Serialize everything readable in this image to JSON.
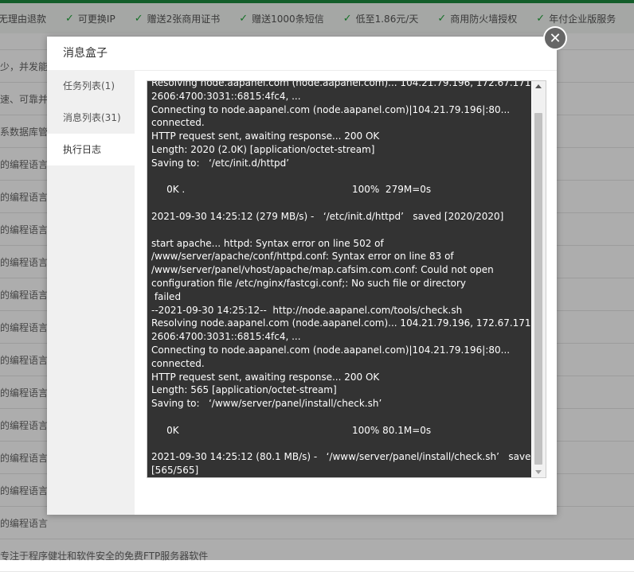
{
  "background": {
    "features": [
      "无理由退款",
      "可更换IP",
      "赠送2张商用证书",
      "赠送1000条短信",
      "低至1.86元/天",
      "商用防火墙授权",
      "年付企业版服务"
    ],
    "rows": [
      "少，并发能",
      "速、可靠并",
      "系数据库管理",
      "的编程语言",
      "的编程语言",
      "的编程语言",
      "的编程语言",
      "的编程语言",
      "的编程语言",
      "的编程语言",
      "的编程语言",
      "的编程语言",
      "的编程语言",
      "的编程语言",
      "的编程语言",
      "专注于程序健壮和软件安全的免费FTP服务器软件"
    ]
  },
  "modal": {
    "title": "消息盒子",
    "close_symbol": "✕",
    "tabs": [
      {
        "label": "任务列表(1)"
      },
      {
        "label": "消息列表(31)"
      },
      {
        "label": "执行日志"
      }
    ],
    "active_tab": "执行日志",
    "log_lines": [
      "Resolving node.aapanel.com (node.aapanel.com)... 104.21.79.196, 172.67.171.7,",
      "2606:4700:3031::6815:4fc4, ...",
      "Connecting to node.aapanel.com (node.aapanel.com)|104.21.79.196|:80...",
      "connected.",
      "HTTP request sent, awaiting response... 200 OK",
      "Length: 2020 (2.0K) [application/octet-stream]",
      "Saving to:   ‘/etc/init.d/httpd’",
      "",
      "     0K .                                                       100%  279M=0s",
      "",
      "2021-09-30 14:25:12 (279 MB/s) -   ‘/etc/init.d/httpd’   saved [2020/2020]",
      "",
      "start apache... httpd: Syntax error on line 502 of",
      "/www/server/apache/conf/httpd.conf: Syntax error on line 83 of",
      "/www/server/panel/vhost/apache/map.cafsim.com.conf: Could not open",
      "configuration file /etc/nginx/fastcgi.conf;: No such file or directory",
      " failed",
      "--2021-09-30 14:25:12--  http://node.aapanel.com/tools/check.sh",
      "Resolving node.aapanel.com (node.aapanel.com)... 104.21.79.196, 172.67.171.7,",
      "2606:4700:3031::6815:4fc4, ...",
      "Connecting to node.aapanel.com (node.aapanel.com)|104.21.79.196|:80...",
      "connected.",
      "HTTP request sent, awaiting response... 200 OK",
      "Length: 565 [application/octet-stream]",
      "Saving to:   ‘/www/server/panel/install/check.sh’",
      "",
      "     0K                                                         100% 80.1M=0s",
      "",
      "2021-09-30 14:25:12 (80.1 MB/s) -   ‘/www/server/panel/install/check.sh’   saved",
      "[565/565]"
    ]
  },
  "colors": {
    "accent_green": "#20a53a",
    "log_bg": "#333333",
    "overlay": "rgba(0,0,0,0.32)"
  }
}
